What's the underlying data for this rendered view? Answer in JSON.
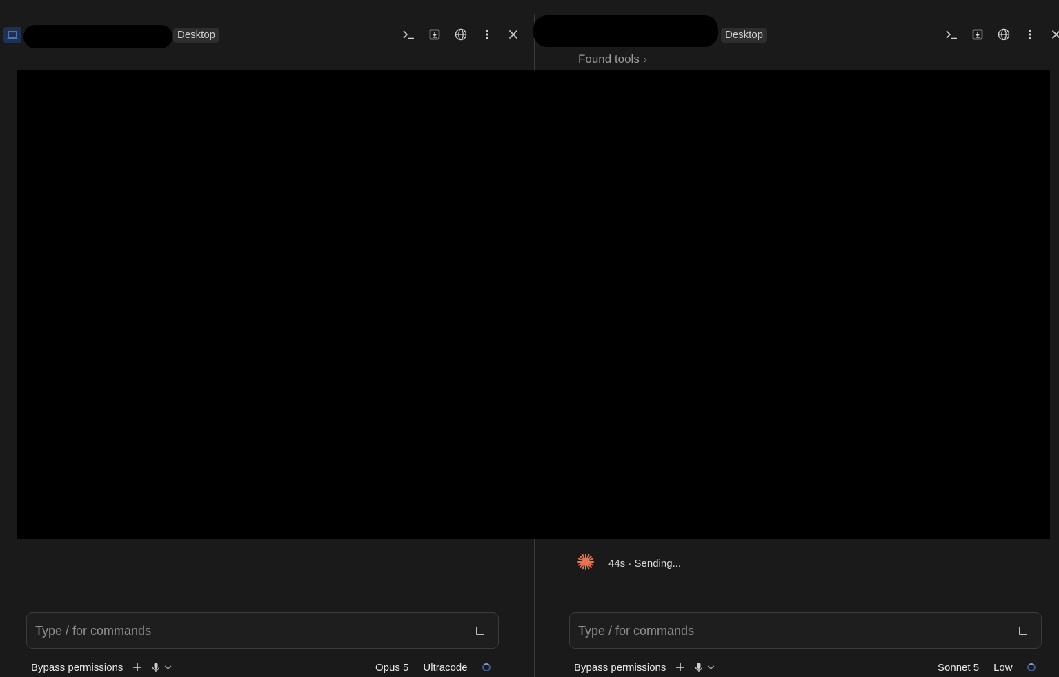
{
  "left_pane": {
    "header": {
      "chip": "Desktop"
    },
    "input": {
      "placeholder": "Type / for commands"
    },
    "footer": {
      "permissions": "Bypass permissions",
      "model": "Opus 5",
      "mode": "Ultracode"
    }
  },
  "right_pane": {
    "header": {
      "chip": "Desktop"
    },
    "found_tools": "Found tools",
    "status": "44s · Sending...",
    "input": {
      "placeholder": "Type / for commands"
    },
    "footer": {
      "permissions": "Bypass permissions",
      "model": "Sonnet 5",
      "effort": "Low"
    }
  },
  "colors": {
    "background": "#1a1a1a",
    "overlay": "#000000",
    "accent_sparkle": "#e8734f",
    "laptop_icon_bg": "#1f3150"
  },
  "icons": [
    "laptop-icon",
    "terminal-icon",
    "download-icon",
    "globe-icon",
    "more-vertical-icon",
    "close-icon",
    "chevron-right-icon",
    "sparkle-icon",
    "stop-icon",
    "plus-icon",
    "microphone-icon",
    "chevron-down-icon",
    "spinner-icon"
  ]
}
